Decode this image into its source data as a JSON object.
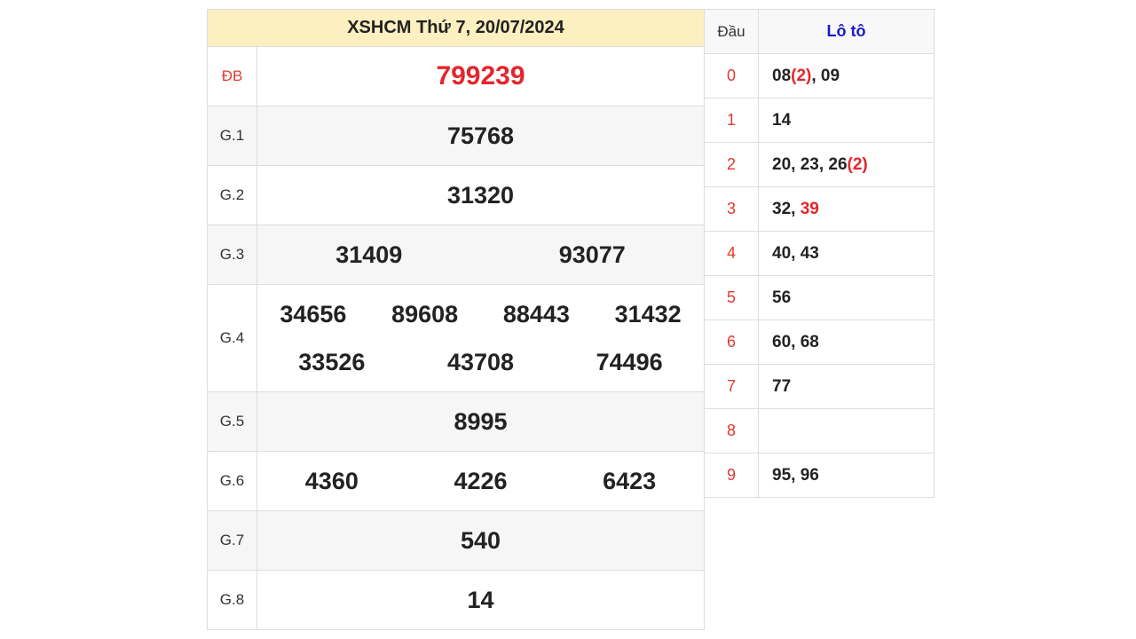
{
  "results": {
    "title": "XSHCM Thứ 7, 20/07/2024",
    "prizes": [
      {
        "label": "ĐB",
        "numbers": [
          "799239"
        ]
      },
      {
        "label": "G.1",
        "numbers": [
          "75768"
        ]
      },
      {
        "label": "G.2",
        "numbers": [
          "31320"
        ]
      },
      {
        "label": "G.3",
        "numbers": [
          "31409",
          "93077"
        ]
      },
      {
        "label": "G.4",
        "numbers": [
          "34656",
          "89608",
          "88443",
          "31432",
          "33526",
          "43708",
          "74496"
        ]
      },
      {
        "label": "G.5",
        "numbers": [
          "8995"
        ]
      },
      {
        "label": "G.6",
        "numbers": [
          "4360",
          "4226",
          "6423"
        ]
      },
      {
        "label": "G.7",
        "numbers": [
          "540"
        ]
      },
      {
        "label": "G.8",
        "numbers": [
          "14"
        ]
      }
    ]
  },
  "loto": {
    "header_dau": "Đầu",
    "header_loto": "Lô tô",
    "rows": [
      {
        "head": "0",
        "parts": [
          {
            "t": "08"
          },
          {
            "t": "(2)",
            "red": true
          },
          {
            "t": ", 09"
          }
        ]
      },
      {
        "head": "1",
        "parts": [
          {
            "t": "14"
          }
        ]
      },
      {
        "head": "2",
        "parts": [
          {
            "t": "20, 23, 26"
          },
          {
            "t": "(2)",
            "red": true
          }
        ]
      },
      {
        "head": "3",
        "parts": [
          {
            "t": "32, "
          },
          {
            "t": "39",
            "red": true
          }
        ]
      },
      {
        "head": "4",
        "parts": [
          {
            "t": "40, 43"
          }
        ]
      },
      {
        "head": "5",
        "parts": [
          {
            "t": "56"
          }
        ]
      },
      {
        "head": "6",
        "parts": [
          {
            "t": "60, 68"
          }
        ]
      },
      {
        "head": "7",
        "parts": [
          {
            "t": "77"
          }
        ]
      },
      {
        "head": "8",
        "parts": []
      },
      {
        "head": "9",
        "parts": [
          {
            "t": "95, 96"
          }
        ]
      }
    ]
  },
  "colors": {
    "special": "#e3262d",
    "label_red": "#e03a2e",
    "header_bg": "#fcefc0",
    "loto_header": "#1a1ac8"
  }
}
